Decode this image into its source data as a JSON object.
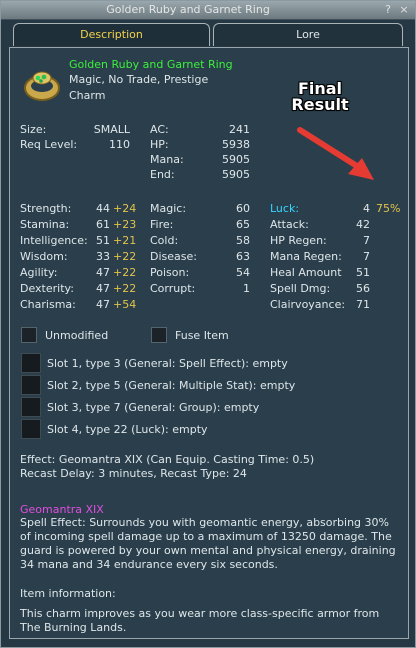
{
  "window": {
    "title": "Golden Ruby and Garnet Ring",
    "help": "?",
    "close": "×"
  },
  "tabs": [
    {
      "label": "Description"
    },
    {
      "label": "Lore"
    }
  ],
  "item": {
    "name": "Golden Ruby and Garnet Ring",
    "flags": "Magic, No Trade, Prestige",
    "type": "Charm"
  },
  "annotation": {
    "line1": "Final",
    "line2": "Result"
  },
  "basic": {
    "size_label": "Size:",
    "size_value": "SMALL",
    "req_label": "Req Level:",
    "req_value": "110",
    "ac_label": "AC:",
    "ac_value": "241",
    "hp_label": "HP:",
    "hp_value": "5938",
    "mana_label": "Mana:",
    "mana_value": "5905",
    "end_label": "End:",
    "end_value": "5905"
  },
  "stats_left": [
    {
      "label": "Strength:",
      "value": "44",
      "bonus": "+24"
    },
    {
      "label": "Stamina:",
      "value": "61",
      "bonus": "+23"
    },
    {
      "label": "Intelligence:",
      "value": "51",
      "bonus": "+21"
    },
    {
      "label": "Wisdom:",
      "value": "33",
      "bonus": "+22"
    },
    {
      "label": "Agility:",
      "value": "47",
      "bonus": "+22"
    },
    {
      "label": "Dexterity:",
      "value": "47",
      "bonus": "+22"
    },
    {
      "label": "Charisma:",
      "value": "47",
      "bonus": "+54"
    }
  ],
  "stats_mid": [
    {
      "label": "Magic:",
      "value": "60"
    },
    {
      "label": "Fire:",
      "value": "65"
    },
    {
      "label": "Cold:",
      "value": "58"
    },
    {
      "label": "Disease:",
      "value": "63"
    },
    {
      "label": "Poison:",
      "value": "54"
    },
    {
      "label": "Corrupt:",
      "value": "1"
    }
  ],
  "stats_right": [
    {
      "label": "Luck:",
      "value": "4",
      "bonus": "75%"
    },
    {
      "label": "Attack:",
      "value": "42"
    },
    {
      "label": "HP Regen:",
      "value": "7"
    },
    {
      "label": "Mana Regen:",
      "value": "7"
    },
    {
      "label": "Heal Amount",
      "value": "51"
    },
    {
      "label": "Spell Dmg:",
      "value": "56"
    },
    {
      "label": "Clairvoyance:",
      "value": "71"
    }
  ],
  "checks": {
    "unmodified": "Unmodified",
    "fuse": "Fuse Item"
  },
  "slots": [
    {
      "label": "Slot 1, type 3 (General: Spell Effect): empty"
    },
    {
      "label": "Slot 2, type 5 (General: Multiple Stat): empty"
    },
    {
      "label": "Slot 3, type 7 (General: Group): empty"
    },
    {
      "label": "Slot 4, type 22 (Luck): empty"
    }
  ],
  "effect": {
    "line1": "Effect: Geomantra XIX (Can Equip. Casting Time: 0.5)",
    "line2": "Recast Delay: 3 minutes, Recast Type: 24"
  },
  "spell": {
    "name": "Geomantra XIX",
    "description": "Spell Effect: Surrounds you with geomantic energy, absorbing 30% of incoming spell damage up to a maximum of 13250 damage. The guard is powered by your own mental and physical energy, draining 34 mana and 34 endurance every six seconds."
  },
  "info": {
    "header": "Item information:",
    "text": "This charm improves as you wear more class-specific armor from The Burning Lands."
  },
  "colors": {
    "name_green": "#3cf03c",
    "bonus_yellow": "#e3c24c",
    "luck_cyan": "#38d4ff",
    "spell_pink": "#e14de1",
    "arrow_red": "#e53b32"
  }
}
